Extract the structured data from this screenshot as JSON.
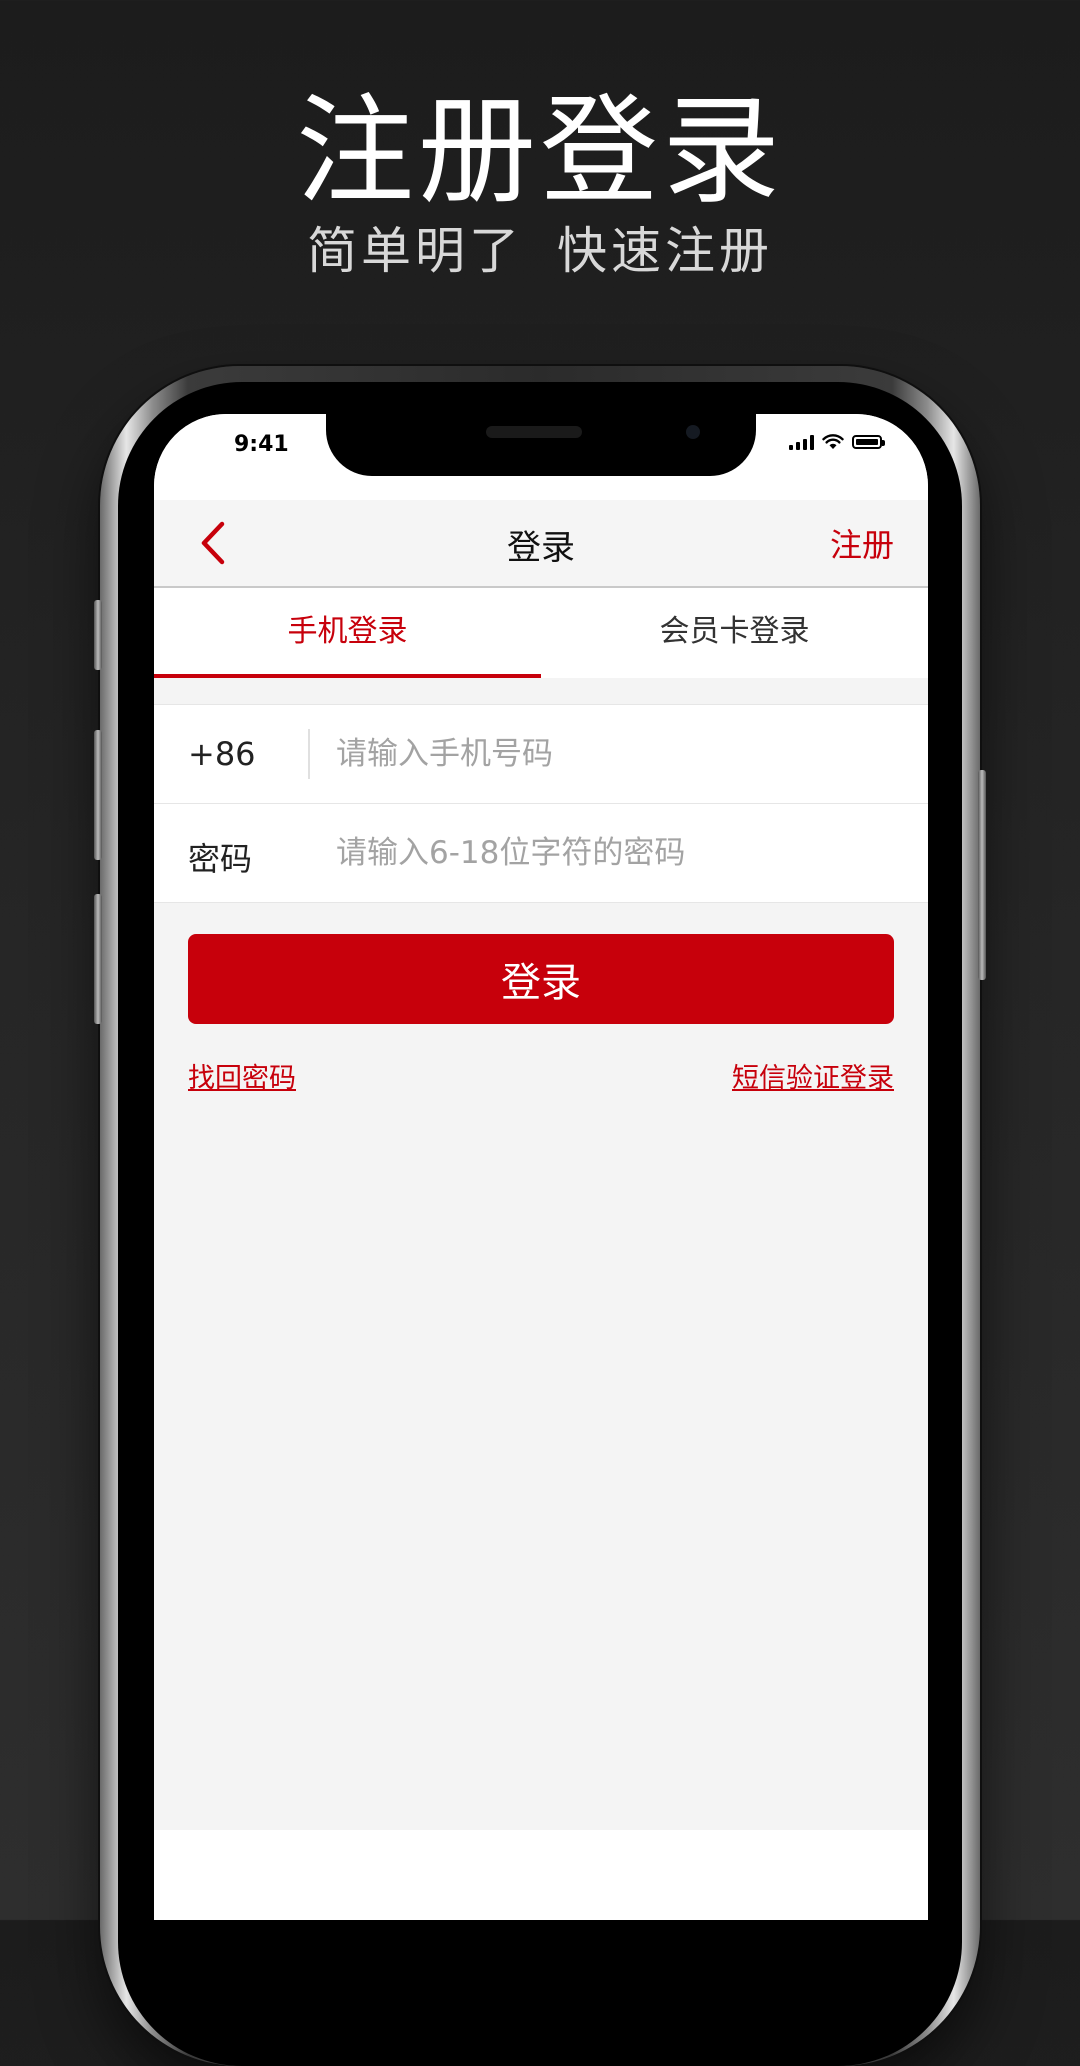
{
  "promo": {
    "headline": "注册登录",
    "subline_1": "简单明了",
    "subline_2": "快速注册"
  },
  "status_bar": {
    "time": "9:41",
    "icons": [
      "signal-icon",
      "wifi-icon",
      "battery-icon"
    ]
  },
  "nav": {
    "title": "登录",
    "register": "注册",
    "back_icon": "chevron-left-icon"
  },
  "tabs": [
    {
      "label": "手机登录",
      "active": true
    },
    {
      "label": "会员卡登录",
      "active": false
    }
  ],
  "form": {
    "phone_prefix": "+86",
    "phone_placeholder": "请输入手机号码",
    "password_label": "密码",
    "password_placeholder": "请输入6-18位字符的密码"
  },
  "actions": {
    "login": "登录",
    "forgot_password": "找回密码",
    "sms_login": "短信验证登录"
  },
  "colors": {
    "accent": "#c7000b",
    "page_background": "#f4f4f4",
    "promo_background": "#1c1c1c"
  }
}
